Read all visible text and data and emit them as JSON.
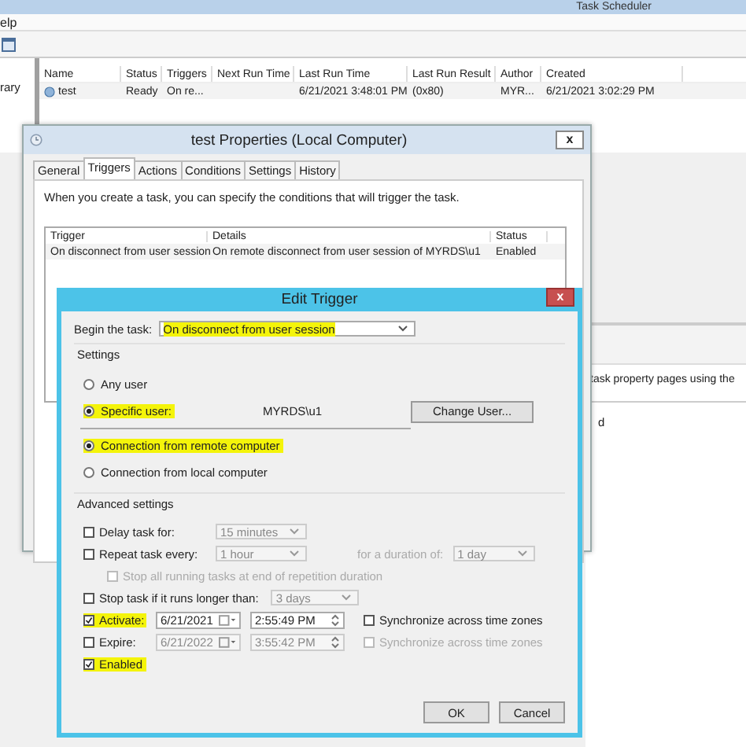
{
  "scheduler": {
    "title": "Task Scheduler",
    "menu": [
      "elp"
    ],
    "sidebar_item": "rary",
    "columns": [
      "Name",
      "Status",
      "Triggers",
      "Next Run Time",
      "Last Run Time",
      "Last Run Result",
      "Author",
      "Created"
    ],
    "rows": [
      {
        "selected": false,
        "cells": [
          "test",
          "Ready",
          "On re...",
          "",
          "6/21/2021 3:48:01 PM",
          "(0x80)",
          "MYR...",
          "6/21/2021 3:02:29 PM"
        ]
      }
    ],
    "detail_text": "task property pages using the",
    "detail_text_2": "d"
  },
  "properties": {
    "title": "test Properties (Local Computer)",
    "close": "x",
    "tabs": [
      {
        "label": "General",
        "selected": false
      },
      {
        "label": "Triggers",
        "selected": true
      },
      {
        "label": "Actions",
        "selected": false
      },
      {
        "label": "Conditions",
        "selected": false
      },
      {
        "label": "Settings",
        "selected": false
      },
      {
        "label": "History",
        "selected": false
      }
    ],
    "intro": "When you create a task, you can specify the conditions that will trigger the task.",
    "columns": [
      "Trigger",
      "Details",
      "Status"
    ],
    "rows": [
      {
        "selected": false,
        "cells": [
          "On disconnect from user session",
          "On remote disconnect from user session of MYRDS\\u1",
          "Enabled"
        ]
      }
    ]
  },
  "edit_trigger": {
    "title": "Edit Trigger",
    "close": "x",
    "begin_label": "Begin the task:",
    "begin_value": "On disconnect from user session",
    "begin_highlighted": true,
    "settings_label": "Settings",
    "user_options": [
      {
        "label": "Any user",
        "selected": false,
        "highlighted": false
      },
      {
        "label": "Specific user:",
        "selected": true,
        "highlighted": true
      }
    ],
    "user_value": "MYRDS\\u1",
    "change_user_button": "Change User...",
    "connection_options": [
      {
        "label": "Connection from remote computer",
        "selected": true,
        "highlighted": true
      },
      {
        "label": "Connection from local computer",
        "selected": false,
        "highlighted": false
      }
    ],
    "advanced_label": "Advanced settings",
    "delay": {
      "label": "Delay task for:",
      "checked": false,
      "value": "15 minutes",
      "disabled": true
    },
    "repeat": {
      "label": "Repeat task every:",
      "checked": false,
      "value": "1 hour",
      "disabled": true,
      "duration_label": "for a duration of:",
      "duration_value": "1 day"
    },
    "stop_all": {
      "label": "Stop all running tasks at end of repetition duration",
      "checked": false,
      "disabled": true
    },
    "stop_task": {
      "label": "Stop task if it runs longer than:",
      "checked": false,
      "value": "3 days",
      "disabled": true
    },
    "schedule": [
      {
        "label": "Activate:",
        "checked": true,
        "highlighted": true,
        "date": "6/21/2021",
        "time": "2:55:49 PM",
        "disabled": false,
        "sync_label": "Synchronize across time zones",
        "sync_checked": false
      },
      {
        "label": "Expire:",
        "checked": false,
        "highlighted": false,
        "date": "6/21/2022",
        "time": "3:55:42 PM",
        "disabled": true,
        "sync_label": "Synchronize across time zones",
        "sync_checked": false
      }
    ],
    "enabled": {
      "label": "Enabled",
      "checked": true,
      "highlighted": true
    },
    "buttons": [
      "OK",
      "Cancel"
    ]
  }
}
